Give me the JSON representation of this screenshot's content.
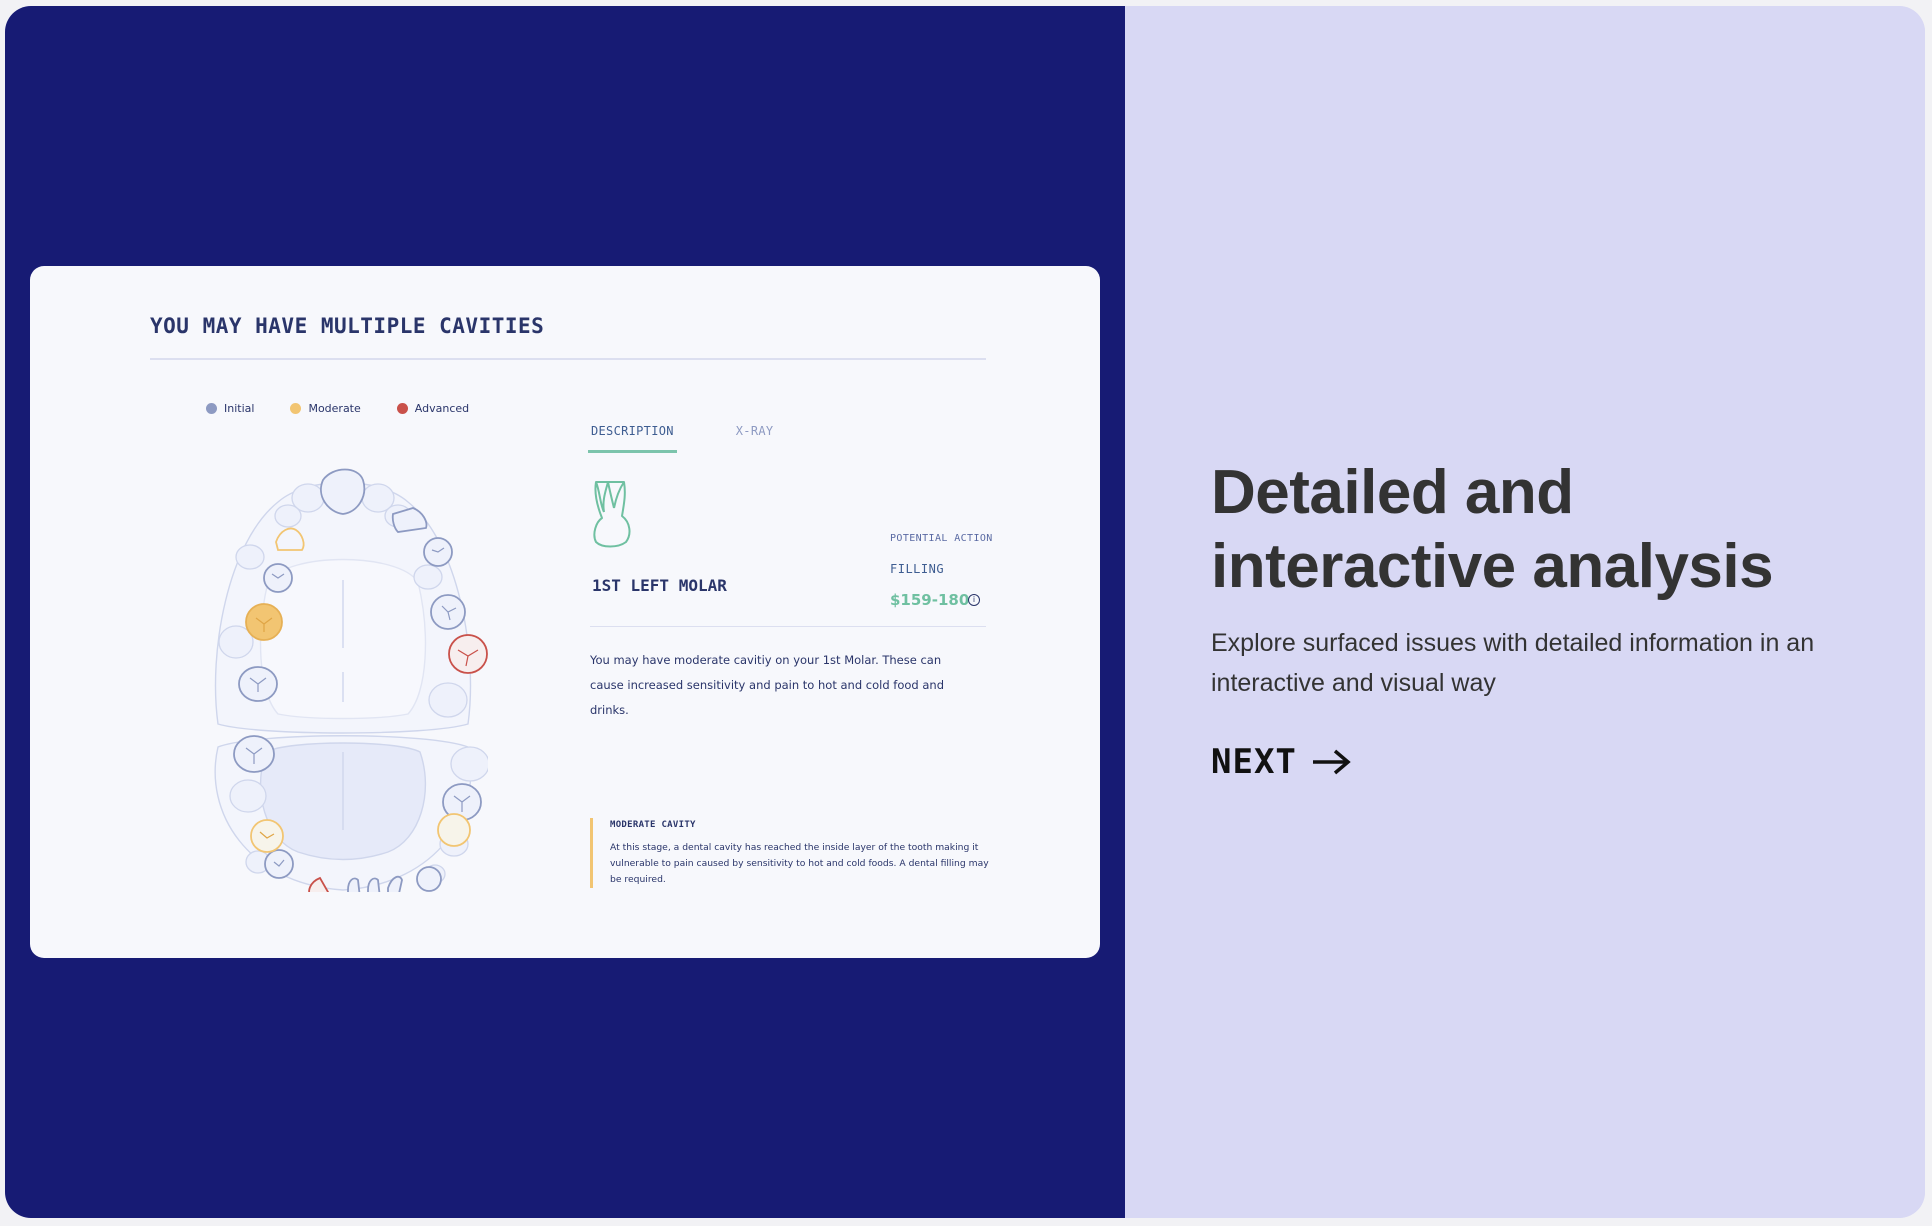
{
  "card": {
    "title": "YOU MAY HAVE MULTIPLE CAVITIES",
    "legend": [
      {
        "label": "Initial",
        "color": "#8d9ac2"
      },
      {
        "label": "Moderate",
        "color": "#f2c572"
      },
      {
        "label": "Advanced",
        "color": "#c9514a"
      }
    ],
    "tabs": [
      {
        "label": "DESCRIPTION",
        "active": true
      },
      {
        "label": "X-RAY",
        "active": false
      }
    ],
    "tooth_name": "1ST LEFT MOLAR",
    "potential_action_label": "POTENTIAL ACTION",
    "action": "FILLING",
    "price": "$159-180",
    "info_icon": "i",
    "description": "You may have moderate cavitiy on your 1st Molar. These can cause increased sensitivity and pain to hot and cold food and drinks.",
    "note": {
      "title": "MODERATE CAVITY",
      "body": "At this stage, a dental cavity has reached the inside layer of the tooth making it vulnerable to pain caused by sensitivity to hot and cold foods. A dental filling may be required."
    }
  },
  "colors": {
    "navy": "#171b74",
    "lavender": "#d8d8f4",
    "mint": "#6fc0a1",
    "initial": "#8d9ac2",
    "moderate": "#f2c572",
    "advanced": "#c9514a"
  },
  "promo": {
    "heading": "Detailed and interactive analysis",
    "subtext": "Explore surfaced issues with detailed information in an interactive and visual way",
    "next_label": "NEXT",
    "next_icon": "arrow-right-icon"
  }
}
